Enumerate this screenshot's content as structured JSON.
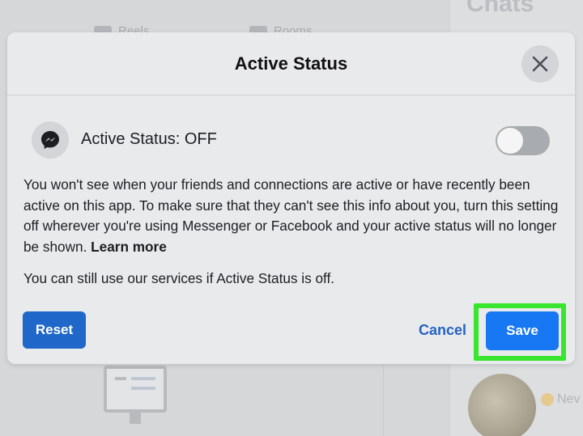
{
  "background": {
    "chats_title": "Chats",
    "tabs": [
      {
        "label": "Reels"
      },
      {
        "label": "Rooms"
      }
    ],
    "new_label": "Nev"
  },
  "modal": {
    "title": "Active Status",
    "status_label": "Active Status: OFF",
    "toggle_on": false,
    "description": "You won't see when your friends and connections are active or have recently been active on this app. To make sure that they can't see this info about you, turn this setting off wherever you're using Messenger or Facebook and your active status will no longer be shown.",
    "learn_more": "Learn more",
    "note": "You can still use our services if Active Status is off.",
    "reset_label": "Reset",
    "cancel_label": "Cancel",
    "save_label": "Save"
  },
  "icons": {
    "close": "close-icon",
    "messenger": "messenger-icon"
  },
  "colors": {
    "primary_button": "#1877f2",
    "reset_button": "#1f67c9",
    "link": "#2563c2",
    "highlight": "#3ae52d",
    "toggle_off": "#a8abaf"
  }
}
